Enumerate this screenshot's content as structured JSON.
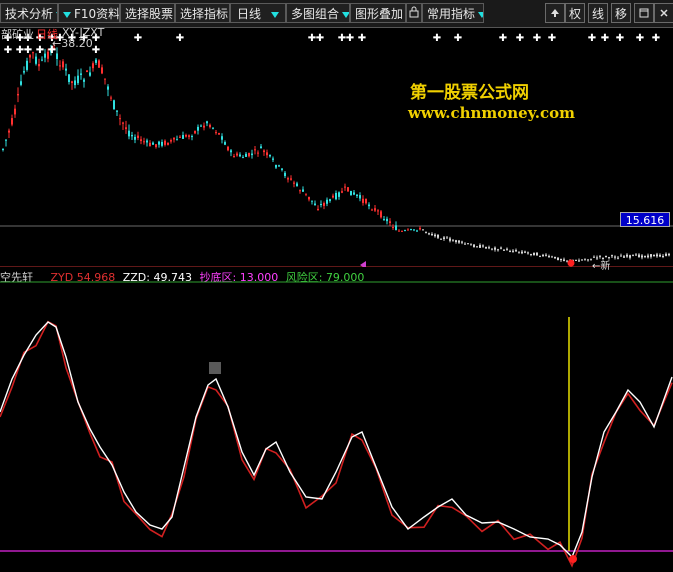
{
  "toolbar": {
    "items": [
      {
        "label": "技术分析",
        "has_dropdown": true
      },
      {
        "label": "F10资料",
        "has_dropdown": true
      },
      {
        "label": "选择股票",
        "has_dropdown": false
      },
      {
        "label": "选择指标",
        "has_dropdown": false
      },
      {
        "label": "日线",
        "has_dropdown": true
      },
      {
        "label": "多图组合",
        "has_dropdown": true
      },
      {
        "label": "图形叠加",
        "has_dropdown": false
      },
      {
        "label": "常用指标",
        "has_dropdown": true
      }
    ],
    "right_buttons": [
      "权",
      "线",
      "移"
    ]
  },
  "main_panel": {
    "stock_label": "部矿业",
    "period_label": "日线",
    "indicator_label": "XY-JZXT",
    "high_price": "38.20",
    "current_price": "15.616",
    "low_mark": "新"
  },
  "watermark": {
    "title": "第一股票公式网",
    "url": "www.chnmoney.com"
  },
  "indicator_panel": {
    "name": "空先轩",
    "values": [
      {
        "label": "ZYD",
        "value": "54.968",
        "color": "#e03030"
      },
      {
        "label": "ZZD",
        "value": "49.743",
        "color": "#ffffff"
      },
      {
        "label": "抄底区",
        "value": "13.000",
        "color": "#ff40ff"
      },
      {
        "label": "风险区",
        "value": "79.000",
        "color": "#40d040"
      }
    ]
  },
  "colors": {
    "up": "#ff3030",
    "down": "#30e0e0",
    "white_line": "#ffffff",
    "red_line": "#d02020",
    "bottom_line": "#c020c0",
    "signal_line": "#e8e000"
  },
  "icons": [
    "dropdown-arrow-icon",
    "close-icon",
    "window-icon",
    "up-icon"
  ]
}
